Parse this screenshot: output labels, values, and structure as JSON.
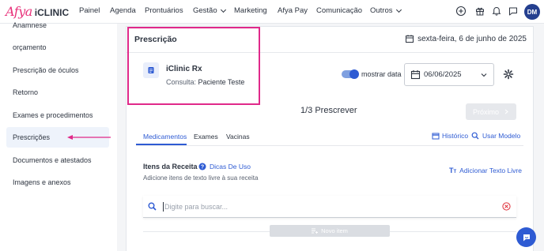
{
  "brand": {
    "name_italic": "Afya",
    "name_bold": "iCLINIC",
    "accent": "#e8317a"
  },
  "nav": {
    "items": [
      "Painel",
      "Agenda",
      "Prontuários",
      "Gestão",
      "Marketing",
      "Afya Pay",
      "Comunicação",
      "Outros"
    ],
    "dropdown_items": [
      "Gestão",
      "Outros"
    ],
    "icons": [
      "add-circle-icon",
      "gift-icon",
      "bell-icon",
      "chat-icon"
    ],
    "avatar": "DM"
  },
  "sidebar": {
    "items": [
      {
        "label": "Anamnese",
        "active": false
      },
      {
        "label": "orçamento",
        "active": false
      },
      {
        "label": "Prescrição de óculos",
        "active": false
      },
      {
        "label": "Retorno",
        "active": false
      },
      {
        "label": "Exames e procedimentos",
        "active": false
      },
      {
        "label": "Prescrições",
        "active": true
      },
      {
        "label": "Documentos e atestados",
        "active": false
      },
      {
        "label": "Imagens e anexos",
        "active": false
      }
    ]
  },
  "panel": {
    "title": "Prescrição",
    "date": "sexta-feira, 6 de junho de 2025",
    "product": "iClinic Rx",
    "consult_label": "Consulta:",
    "patient": "Paciente Teste",
    "toggle_label": "mostrar data",
    "toggle_on": true,
    "date_value": "06/06/2025",
    "step": "1/3 Prescrever",
    "next_label": "Próximo",
    "tabs": [
      "Medicamentos",
      "Exames",
      "Vacinas"
    ],
    "active_tab": "Medicamentos",
    "history_label": "Histórico",
    "use_model_label": "Usar Modelo",
    "items_title": "Itens da Receita",
    "tips_label": "Dicas De Uso",
    "add_free_text": "Adicionar Texto Livre",
    "items_sub": "Adicione itens de texto livre à sua receita",
    "search_placeholder": "Digite para buscar...",
    "new_item_label": "Novo item"
  },
  "colors": {
    "primary": "#2e5bd3",
    "highlight": "#e0298a",
    "clear_icon": "#e0323c"
  }
}
